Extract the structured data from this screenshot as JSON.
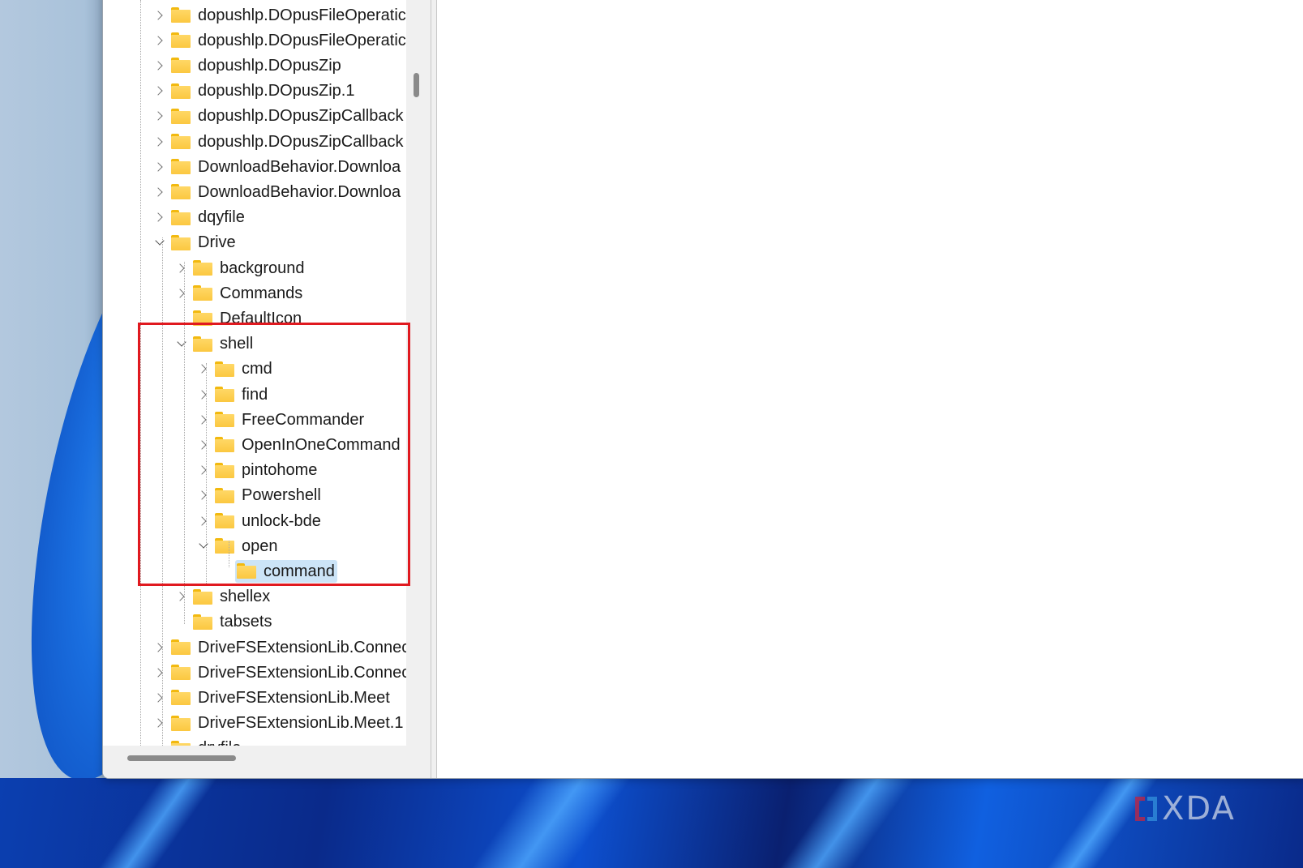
{
  "window": {
    "app": "Registry Editor"
  },
  "tree": {
    "items": [
      {
        "label": "dopushlp.DOpusFileOperatic",
        "level": 0,
        "expander": "collapsed"
      },
      {
        "label": "dopushlp.DOpusFileOperatic",
        "level": 0,
        "expander": "collapsed"
      },
      {
        "label": "dopushlp.DOpusZip",
        "level": 0,
        "expander": "collapsed"
      },
      {
        "label": "dopushlp.DOpusZip.1",
        "level": 0,
        "expander": "collapsed"
      },
      {
        "label": "dopushlp.DOpusZipCallback",
        "level": 0,
        "expander": "collapsed"
      },
      {
        "label": "dopushlp.DOpusZipCallback",
        "level": 0,
        "expander": "collapsed"
      },
      {
        "label": "DownloadBehavior.Downloa",
        "level": 0,
        "expander": "collapsed"
      },
      {
        "label": "DownloadBehavior.Downloa",
        "level": 0,
        "expander": "collapsed"
      },
      {
        "label": "dqyfile",
        "level": 0,
        "expander": "collapsed"
      },
      {
        "label": "Drive",
        "level": 0,
        "expander": "expanded"
      },
      {
        "label": "background",
        "level": 1,
        "expander": "collapsed"
      },
      {
        "label": "Commands",
        "level": 1,
        "expander": "collapsed"
      },
      {
        "label": "DefaultIcon",
        "level": 1,
        "expander": "none"
      },
      {
        "label": "shell",
        "level": 1,
        "expander": "expanded"
      },
      {
        "label": "cmd",
        "level": 2,
        "expander": "collapsed"
      },
      {
        "label": "find",
        "level": 2,
        "expander": "collapsed"
      },
      {
        "label": "FreeCommander",
        "level": 2,
        "expander": "collapsed"
      },
      {
        "label": "OpenInOneCommand",
        "level": 2,
        "expander": "collapsed"
      },
      {
        "label": "pintohome",
        "level": 2,
        "expander": "collapsed"
      },
      {
        "label": "Powershell",
        "level": 2,
        "expander": "collapsed"
      },
      {
        "label": "unlock-bde",
        "level": 2,
        "expander": "collapsed"
      },
      {
        "label": "open",
        "level": 2,
        "expander": "expanded"
      },
      {
        "label": "command",
        "level": 3,
        "expander": "none",
        "selected": true
      },
      {
        "label": "shellex",
        "level": 1,
        "expander": "collapsed"
      },
      {
        "label": "tabsets",
        "level": 1,
        "expander": "none"
      },
      {
        "label": "DriveFSExtensionLib.Connec",
        "level": 0,
        "expander": "collapsed"
      },
      {
        "label": "DriveFSExtensionLib.Connec",
        "level": 0,
        "expander": "collapsed"
      },
      {
        "label": "DriveFSExtensionLib.Meet",
        "level": 0,
        "expander": "collapsed"
      },
      {
        "label": "DriveFSExtensionLib.Meet.1",
        "level": 0,
        "expander": "collapsed"
      },
      {
        "label": "drvfile",
        "level": 0,
        "expander": "none"
      }
    ]
  },
  "annotation": {
    "highlight_color": "#e0191f",
    "highlighted_path": "Drive\\shell\\open\\command"
  },
  "watermark": {
    "text": "XDA"
  },
  "colors": {
    "selection": "#cce4f7",
    "folder": "#fbc840"
  }
}
